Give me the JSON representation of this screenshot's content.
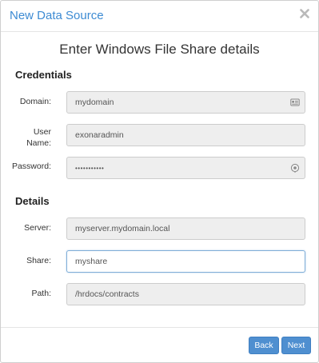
{
  "dialog": {
    "title": "New Data Source",
    "close_icon": "close-icon",
    "subtitle": "Enter Windows File Share details"
  },
  "credentials": {
    "heading": "Credentials",
    "domain": {
      "label": "Domain:",
      "value": "mydomain",
      "icon": "id-card-icon"
    },
    "username": {
      "label_line1": "User",
      "label_line2": "Name:",
      "value": "exonaradmin"
    },
    "password": {
      "label": "Password:",
      "value": "•••••••••••",
      "icon": "eye-icon"
    }
  },
  "details": {
    "heading": "Details",
    "server": {
      "label": "Server:",
      "value": "myserver.mydomain.local"
    },
    "share": {
      "label": "Share:",
      "value": "myshare"
    },
    "path": {
      "label": "Path:",
      "value": "/hrdocs/contracts"
    }
  },
  "footer": {
    "back_label": "Back",
    "next_label": "Next"
  },
  "colors": {
    "title_blue": "#3d8bd3",
    "button_blue": "#4f8fd0",
    "input_bg": "#eeeeee"
  }
}
